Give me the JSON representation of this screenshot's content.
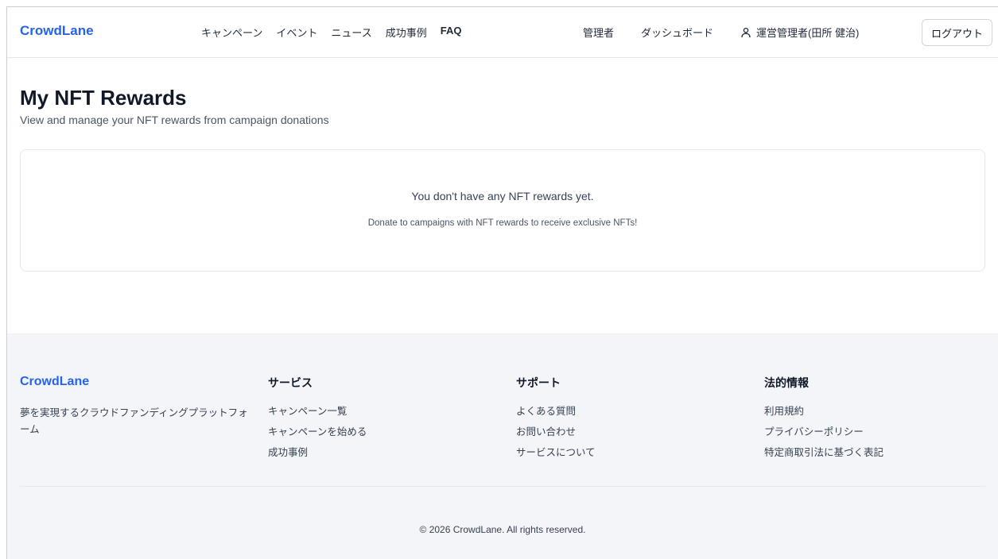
{
  "header": {
    "logo": "CrowdLane",
    "nav": [
      {
        "label": "キャンペーン"
      },
      {
        "label": "イベント"
      },
      {
        "label": "ニュース"
      },
      {
        "label": "成功事例"
      },
      {
        "label": "FAQ"
      }
    ],
    "admin_label": "管理者",
    "dashboard_label": "ダッシュボード",
    "user_name": "運営管理者(田所 健治)",
    "logout_label": "ログアウト"
  },
  "main": {
    "title": "My NFT Rewards",
    "subtitle": "View and manage your NFT rewards from campaign donations",
    "empty_title": "You don't have any NFT rewards yet.",
    "empty_hint": "Donate to campaigns with NFT rewards to receive exclusive NFTs!"
  },
  "footer": {
    "logo": "CrowdLane",
    "tagline": "夢を実現するクラウドファンディングプラットフォーム",
    "columns": [
      {
        "title": "サービス",
        "links": [
          "キャンペーン一覧",
          "キャンペーンを始める",
          "成功事例"
        ]
      },
      {
        "title": "サポート",
        "links": [
          "よくある質問",
          "お問い合わせ",
          "サービスについて"
        ]
      },
      {
        "title": "法的情報",
        "links": [
          "利用規約",
          "プライバシーポリシー",
          "特定商取引法に基づく表記"
        ]
      }
    ],
    "copyright": "© 2026 CrowdLane. All rights reserved."
  },
  "colors": {
    "brand": "#2563eb",
    "footer_bg": "#f3f5f8"
  },
  "icons": {
    "user": "user-icon"
  }
}
